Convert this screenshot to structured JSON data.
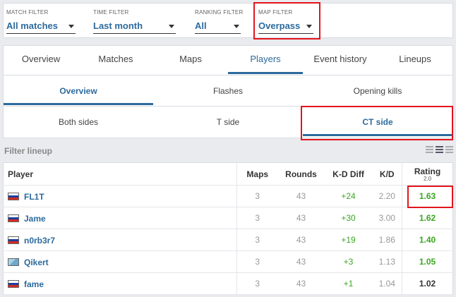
{
  "filters": [
    {
      "label": "MATCH FILTER",
      "value": "All matches"
    },
    {
      "label": "TIME FILTER",
      "value": "Last month"
    },
    {
      "label": "RANKING FILTER",
      "value": "All"
    },
    {
      "label": "MAP FILTER",
      "value": "Overpass"
    }
  ],
  "main_tabs": [
    "Overview",
    "Matches",
    "Maps",
    "Players",
    "Event history",
    "Lineups"
  ],
  "main_tab_active": "Players",
  "sub_tabs": [
    "Overview",
    "Flashes",
    "Opening kills"
  ],
  "sub_tab_active": "Overview",
  "side_tabs": [
    "Both sides",
    "T side",
    "CT side"
  ],
  "side_tab_active": "CT side",
  "lineup_label": "Filter lineup",
  "table": {
    "headers": {
      "player": "Player",
      "maps": "Maps",
      "rounds": "Rounds",
      "kd_diff": "K-D Diff",
      "kd": "K/D",
      "rating": "Rating",
      "rating_version": "2.0"
    },
    "rows": [
      {
        "name": "FL1T",
        "flag": "russia-flag",
        "maps": "3",
        "rounds": "43",
        "kd_diff": "+24",
        "kd": "2.20",
        "rating": "1.63"
      },
      {
        "name": "Jame",
        "flag": "russia-flag",
        "maps": "3",
        "rounds": "43",
        "kd_diff": "+30",
        "kd": "3.00",
        "rating": "1.62"
      },
      {
        "name": "n0rb3r7",
        "flag": "russia-flag",
        "maps": "3",
        "rounds": "43",
        "kd_diff": "+19",
        "kd": "1.86",
        "rating": "1.40"
      },
      {
        "name": "Qikert",
        "flag": "finland-flag",
        "maps": "3",
        "rounds": "43",
        "kd_diff": "+3",
        "kd": "1.13",
        "rating": "1.05"
      },
      {
        "name": "fame",
        "flag": "russia-flag",
        "maps": "3",
        "rounds": "43",
        "kd_diff": "+1",
        "kd": "1.04",
        "rating": "1.02"
      }
    ]
  },
  "colors": {
    "accent": "#2c6a9d",
    "positive": "#3aa620",
    "highlight_box": "#e3141e"
  }
}
